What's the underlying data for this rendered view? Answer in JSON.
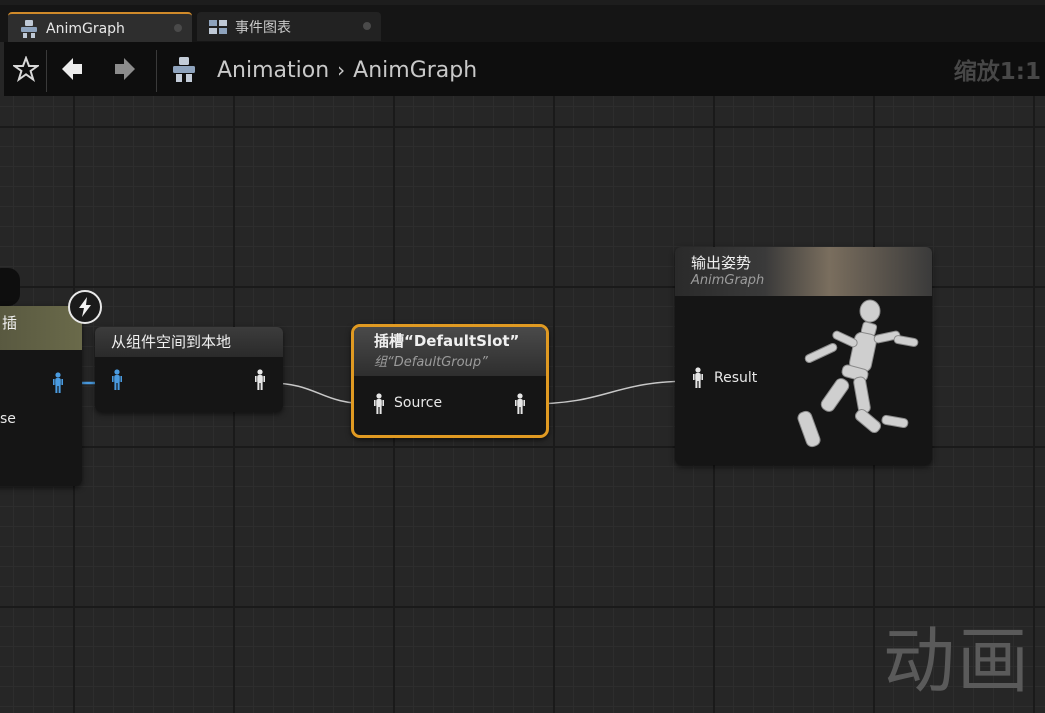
{
  "tabs": [
    {
      "label": "AnimGraph",
      "icon": "anim-graph-icon",
      "active": true
    },
    {
      "label": "事件图表",
      "icon": "event-graph-icon",
      "active": false
    }
  ],
  "breadcrumb": {
    "root": "Animation",
    "separator": "›",
    "current": "AnimGraph"
  },
  "zoom_label": "缩放1:1",
  "nodes": {
    "left_partial": {
      "title": "插",
      "pin_text": "se"
    },
    "component_to_local": {
      "title": "从组件空间到本地"
    },
    "slot": {
      "title": "插槽“DefaultSlot”",
      "subtitle": "组“DefaultGroup”",
      "input_pin": "Source"
    },
    "output_pose": {
      "title": "输出姿势",
      "subtitle": "AnimGraph",
      "input_pin": "Result"
    }
  },
  "watermark": "动画",
  "colors": {
    "accent": "#d08a2a",
    "slot_border": "#e09a22",
    "pin_blue": "#4a9be0",
    "pin_white": "#e6e6e6"
  }
}
